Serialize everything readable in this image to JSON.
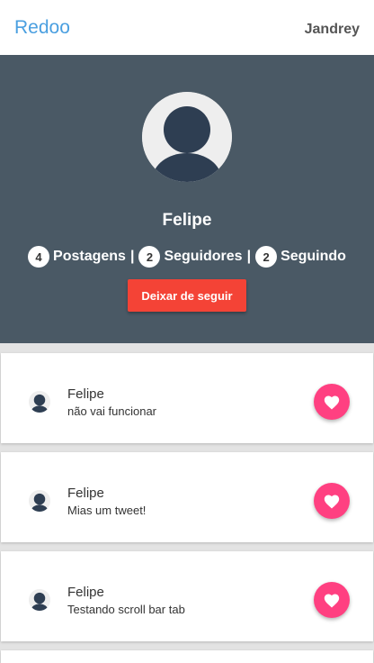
{
  "header": {
    "brand": "Redoo",
    "username": "Jandrey"
  },
  "profile": {
    "name": "Felipe",
    "stats": [
      {
        "count": "4",
        "label": "Postagens"
      },
      {
        "count": "2",
        "label": "Seguidores"
      },
      {
        "count": "2",
        "label": "Seguindo"
      }
    ],
    "separator": "|",
    "unfollow_label": "Deixar de seguir"
  },
  "posts": [
    {
      "author": "Felipe",
      "text": "não vai funcionar"
    },
    {
      "author": "Felipe",
      "text": "Mias um tweet!"
    },
    {
      "author": "Felipe",
      "text": "Testando scroll bar tab"
    }
  ],
  "colors": {
    "brand": "#4a9fe0",
    "profile_bg": "#4a5965",
    "unfollow": "#f44336",
    "like": "#ff4081"
  },
  "icons": {
    "avatar": "user-avatar-icon",
    "like": "heart-icon"
  }
}
